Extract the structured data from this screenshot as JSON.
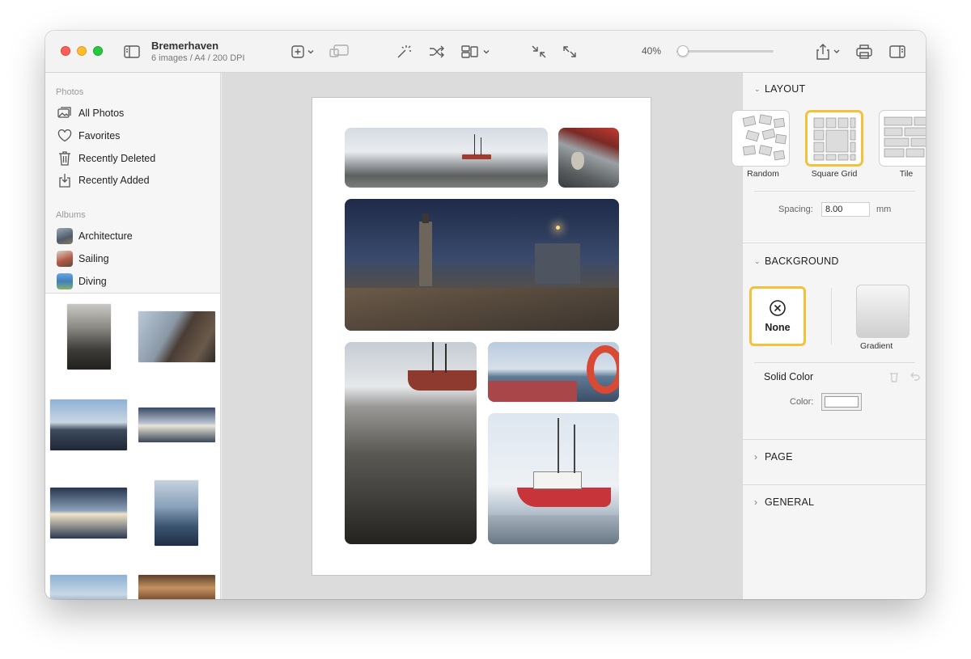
{
  "window": {
    "title": "Bremerhaven",
    "subtitle": "6 images / A4 / 200 DPI",
    "zoom": "40%",
    "zoom_level": 0.02
  },
  "sidebar": {
    "photos_header": "Photos",
    "photos": [
      {
        "label": "All Photos",
        "icon": "photos-icon"
      },
      {
        "label": "Favorites",
        "icon": "heart-icon"
      },
      {
        "label": "Recently Deleted",
        "icon": "trash-icon"
      },
      {
        "label": "Recently Added",
        "icon": "download-tray-icon"
      }
    ],
    "albums_header": "Albums",
    "albums": [
      {
        "label": "Architecture",
        "color": "#7a8a9a"
      },
      {
        "label": "Sailing",
        "color": "#b06a55"
      },
      {
        "label": "Diving",
        "color": "#5a90c0"
      }
    ]
  },
  "inspector": {
    "layout": {
      "header": "LAYOUT",
      "options": [
        "Random",
        "Square Grid",
        "Tile"
      ],
      "selected": "Square Grid",
      "spacing_label": "Spacing:",
      "spacing_value": "8.00",
      "spacing_unit": "mm"
    },
    "background": {
      "header": "BACKGROUND",
      "none_label": "None",
      "gradient_label": "Gradient",
      "solid_label": "Solid Color",
      "color_label": "Color:",
      "color_value": "#ffffff"
    },
    "page_header": "PAGE",
    "general_header": "GENERAL"
  },
  "colors": {
    "selection": "#f5c13d",
    "traffic_red": "#fe5f57",
    "traffic_yellow": "#febc2e",
    "traffic_green": "#28c840"
  }
}
